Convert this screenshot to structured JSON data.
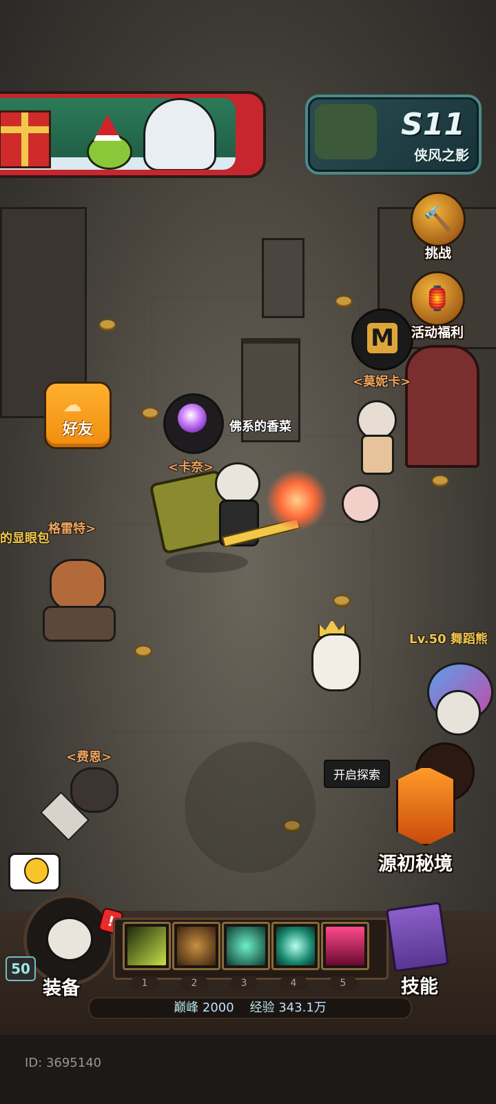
{
  "season": {
    "title": "S11",
    "subtitle": "侠风之影"
  },
  "side_menu": {
    "challenge_label": "挑战",
    "events_label": "活动福利"
  },
  "friends_button": {
    "label": "好友"
  },
  "characters": {
    "npc_monica": "<莫妮卡>",
    "player_title_right": "佛系的香菜",
    "npc_kanai": "<卡奈>",
    "npc_greta": "格雷特>",
    "npc_left_partial": "的显眼包",
    "npc_fein": "<费恩>",
    "other_player": "Lv.50 舞蹈熊"
  },
  "explore": {
    "tag": "开启探索",
    "zone_label": "源初秘境"
  },
  "bottom_bar": {
    "level": "50",
    "alert_mark": "!",
    "equip_label": "装备",
    "skill_label": "技能",
    "slots": [
      "1",
      "2",
      "3",
      "4",
      "5"
    ],
    "peak_key": "巅峰",
    "peak_value": "2000",
    "exp_key": "经验",
    "exp_value": "343.1万"
  },
  "footer": {
    "id_text": "ID: 3695140"
  },
  "colors": {
    "npc_name": "#f2a35a",
    "accent_orange": "#f08d10",
    "season_border": "#4a8a8a"
  }
}
